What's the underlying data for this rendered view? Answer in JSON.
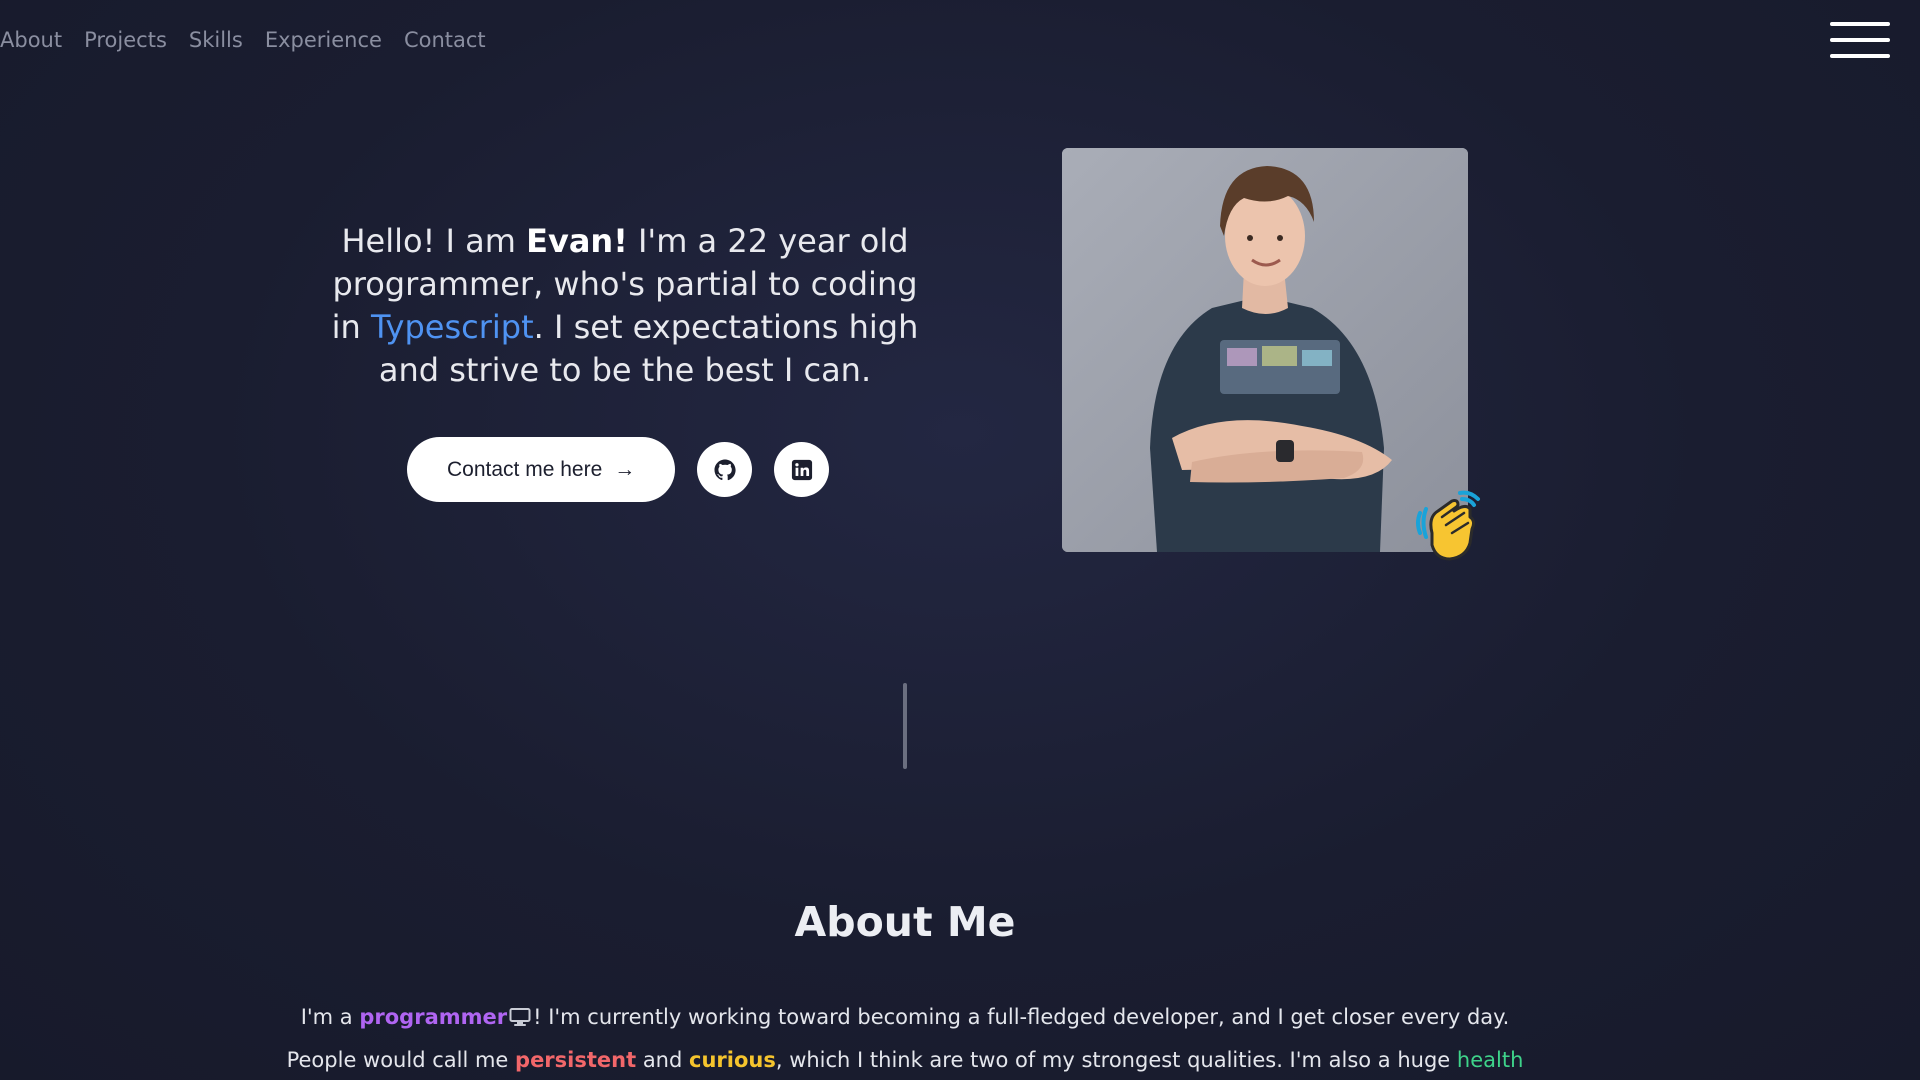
{
  "nav": {
    "items": [
      {
        "label": "About"
      },
      {
        "label": "Projects"
      },
      {
        "label": "Skills"
      },
      {
        "label": "Experience"
      },
      {
        "label": "Contact"
      }
    ],
    "menu_icon": "hamburger-menu-icon"
  },
  "hero": {
    "greeting": "Hello! I am ",
    "name": "Evan!",
    "line1_rest": " I'm a 22 year old programmer, who's partial to coding in ",
    "language": "Typescript",
    "line_end": ". I set expectations high and strive to be the best I can.",
    "contact_button": "Contact me here",
    "contact_arrow": "→",
    "github_icon": "github-icon",
    "linkedin_icon": "linkedin-icon",
    "photo_icon": "profile-photo",
    "wave_emoji": "👋",
    "accent_color": "#4f93f2"
  },
  "about": {
    "title": "About Me",
    "p1_a": "I'm a ",
    "p1_programmer": "programmer",
    "p1_b": "! I'm currently working toward becoming a full-fledged developer, and I get closer every day.",
    "p2_a": "People would call me ",
    "p2_persistent": "persistent",
    "p2_and": " and ",
    "p2_curious": "curious",
    "p2_b": ", which I think are two of my strongest qualities. I'm also a huge ",
    "p2_health": "health",
    "colors": {
      "programmer": "#b065f2",
      "persistent": "#f2676a",
      "curious": "#f5c42d",
      "health": "#3ed38a"
    }
  }
}
